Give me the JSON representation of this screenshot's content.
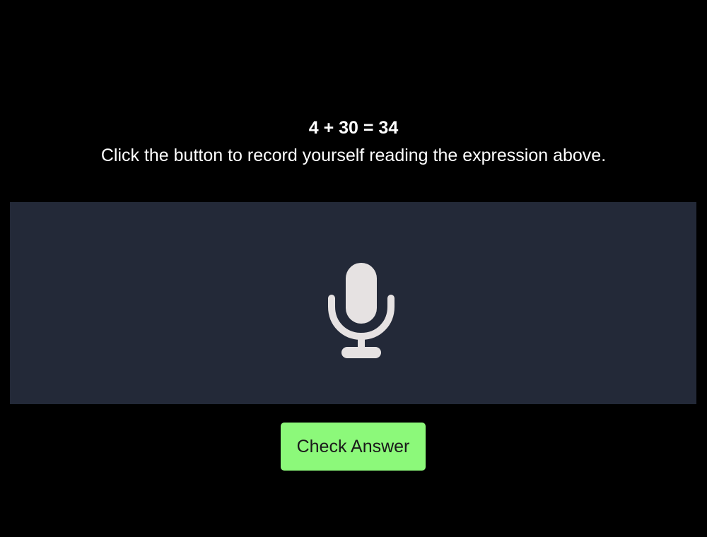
{
  "prompt": {
    "expression": "4 + 30 = 34",
    "instructions": "Click the button to record yourself reading the expression above."
  },
  "recorder": {
    "icon": "microphone-icon"
  },
  "actions": {
    "check_label": "Check Answer"
  },
  "colors": {
    "background": "#000000",
    "recorder_panel": "#232938",
    "mic_icon": "#e6e2e2",
    "check_button": "#8cf97a",
    "check_button_text": "#1a1a1a"
  }
}
